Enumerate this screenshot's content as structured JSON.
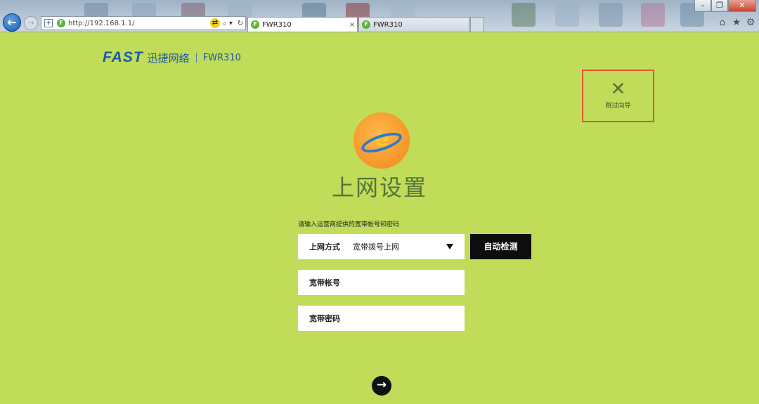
{
  "browser": {
    "url": "http://192.168.1.1/",
    "tabs": [
      {
        "label": "FWR310",
        "active": true
      },
      {
        "label": "FWR310",
        "active": false
      }
    ],
    "tab_close": "×",
    "favicon_letter": "F",
    "window_controls": {
      "minimize": "–",
      "restore": "❐",
      "close": "✕"
    },
    "nav": {
      "back": "←",
      "forward": "→"
    },
    "address_buttons": {
      "compat": "⇄",
      "search": "⌕ ▾",
      "refresh": "↻"
    },
    "tools": {
      "home": "⌂",
      "favorites": "★",
      "settings": "⚙"
    }
  },
  "brand": {
    "logo": "FAST",
    "name": "迅捷网络",
    "model": "FWR310"
  },
  "skip": {
    "icon": "✕",
    "label": "跳过向导"
  },
  "wizard": {
    "title": "上网设置",
    "logo_letter": "e",
    "prompt": "请输入运营商提供的宽带帐号和密码",
    "connection_type": {
      "label": "上网方式",
      "value": "宽带拨号上网"
    },
    "auto_detect": "自动检测",
    "account_placeholder": "宽带帐号",
    "password_placeholder": "宽带密码",
    "next_icon": "→"
  },
  "colors": {
    "page_bg": "#c0dc58",
    "brand_blue": "#1e5aa8",
    "highlight_border": "#e2562d",
    "title_green": "#55743a"
  }
}
